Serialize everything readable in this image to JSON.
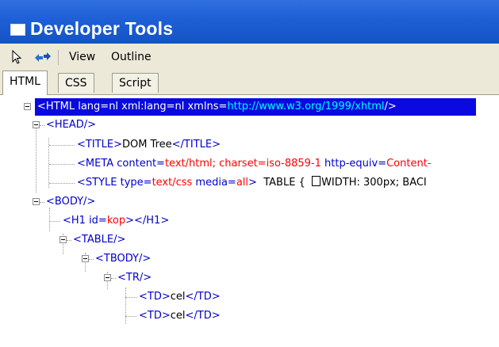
{
  "window": {
    "title": "Developer Tools"
  },
  "toolbar": {
    "pointer_icon": "cursor-pointer-icon",
    "refresh_icon": "arrows-icon",
    "view_label": "View",
    "outline_label": "Outline"
  },
  "tabs": [
    {
      "label": "HTML",
      "active": true
    },
    {
      "label": "CSS",
      "active": false
    },
    {
      "label": "Script",
      "active": false
    }
  ],
  "tree": {
    "html": {
      "open": "<HTML",
      "attr1": " lang=",
      "val1": "nl",
      "attr2": " xml:lang=",
      "val2": "nl",
      "attr3": " xmlns=",
      "val3": "http://www.w3.org/1999/xhtml",
      "close": "/>"
    },
    "head": {
      "tag": "<HEAD/>"
    },
    "title": {
      "open": "<TITLE>",
      "text": "DOM Tree",
      "close": "</TITLE>"
    },
    "meta": {
      "open": "<META content=",
      "val1": "text/html; charset=iso-8859-1",
      "attr2": " http-equiv=",
      "val2": "Content-"
    },
    "style": {
      "open": "<STYLE type=",
      "val1": "text/css",
      "attr2": " media=",
      "val2": "all",
      "close": ">",
      "text1": "  TABLE {  ",
      "text2": "WIDTH: 300px; BACI"
    },
    "body": {
      "tag": "<BODY/>"
    },
    "h1": {
      "open": "<H1 id=",
      "val": "kop",
      "close": "></H1>"
    },
    "table": {
      "tag": "<TABLE/>"
    },
    "tbody": {
      "tag": "<TBODY/>"
    },
    "tr": {
      "tag": "<TR/>"
    },
    "td1": {
      "open": "<TD>",
      "text": "cel",
      "close": "</TD>"
    },
    "td2": {
      "open": "<TD>",
      "text": "cel",
      "close": "</TD>"
    }
  },
  "colors": {
    "titlebar": "#1e5fd6",
    "tag": "#0000cc",
    "attr_value": "#ff0000",
    "selection": "#0a0ae0",
    "url_selected": "#00ffff"
  }
}
